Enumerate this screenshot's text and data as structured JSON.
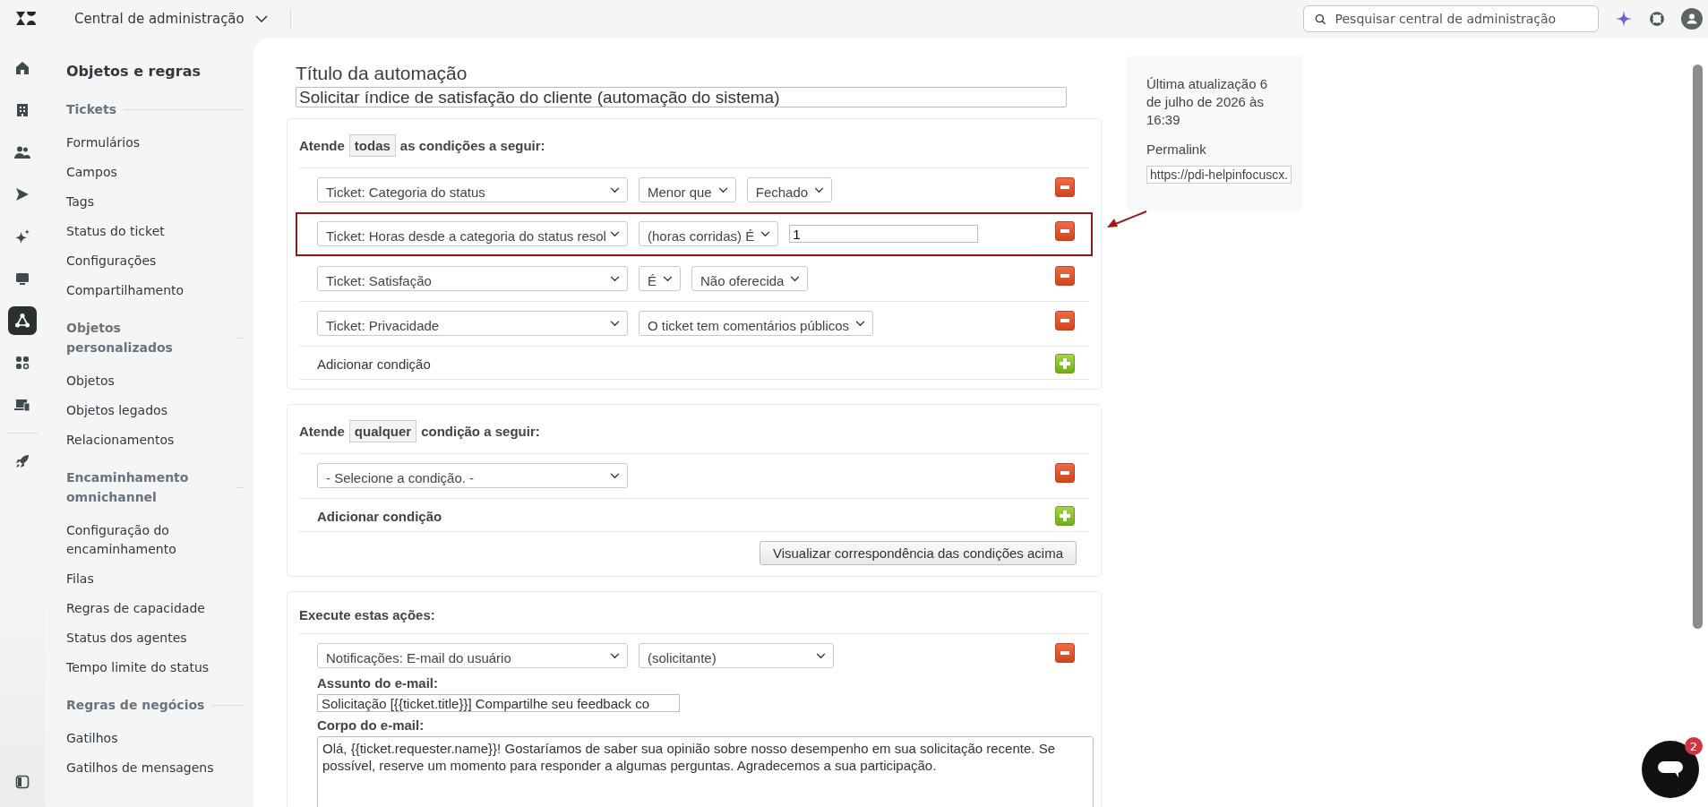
{
  "header": {
    "product": "Central de administração",
    "search_placeholder": "Pesquisar central de administração"
  },
  "rail": [
    {
      "kind": "home",
      "selected": false
    },
    {
      "kind": "building",
      "selected": false
    },
    {
      "kind": "people",
      "selected": false
    },
    {
      "kind": "send",
      "selected": false
    },
    {
      "kind": "sparkle",
      "selected": false
    },
    {
      "kind": "monitor",
      "selected": false
    },
    {
      "kind": "objects",
      "selected": true
    },
    {
      "kind": "apps",
      "selected": false
    },
    {
      "kind": "devices",
      "selected": false
    },
    {
      "kind": "rocket",
      "selected": false
    }
  ],
  "sidebar": {
    "title": "Objetos e regras",
    "sections": [
      {
        "heading": "Tickets",
        "items": [
          "Formulários",
          "Campos",
          "Tags",
          "Status do ticket",
          "Configurações",
          "Compartilhamento"
        ]
      },
      {
        "heading": "Objetos personalizados",
        "items": [
          "Objetos",
          "Objetos legados",
          "Relacionamentos"
        ]
      },
      {
        "heading": "Encaminhamento omnichannel",
        "items": [
          "Configuração do encaminhamento",
          "Filas",
          "Regras de capacidade",
          "Status dos agentes",
          "Tempo limite do status"
        ]
      },
      {
        "heading": "Regras de negócios",
        "items": [
          "Gatilhos",
          "Gatilhos de mensagens"
        ]
      }
    ]
  },
  "automation": {
    "title_label": "Título da automação",
    "title_value": "Solicitar índice de satisfação do cliente (automação do sistema)",
    "all_conditions": {
      "prefix": "Atende",
      "quantifier": "todas",
      "suffix": "as condições a seguir:",
      "add_label": "Adicionar condição",
      "rows": [
        {
          "highlighted": false,
          "controls": [
            {
              "kind": "select",
              "value": "Ticket: Categoria do status"
            },
            {
              "kind": "select",
              "value": "Menor que"
            },
            {
              "kind": "select",
              "value": "Fechado"
            }
          ]
        },
        {
          "highlighted": true,
          "controls": [
            {
              "kind": "select",
              "value": "Ticket: Horas desde a categoria do status resol"
            },
            {
              "kind": "select",
              "value": "(horas corridas) É"
            },
            {
              "kind": "input",
              "value": "1"
            }
          ]
        },
        {
          "highlighted": false,
          "controls": [
            {
              "kind": "select",
              "value": "Ticket: Satisfação"
            },
            {
              "kind": "select",
              "value": "É"
            },
            {
              "kind": "select",
              "value": "Não oferecida"
            }
          ]
        },
        {
          "highlighted": false,
          "controls": [
            {
              "kind": "select",
              "value": "Ticket: Privacidade"
            },
            {
              "kind": "select",
              "value": "O ticket tem comentários públicos"
            }
          ]
        }
      ]
    },
    "any_conditions": {
      "prefix": "Atende",
      "quantifier": "qualquer",
      "suffix": "condição a seguir:",
      "add_label": "Adicionar condição",
      "preview_button": "Visualizar correspondência das condições acima",
      "rows": [
        {
          "highlighted": false,
          "controls": [
            {
              "kind": "select",
              "value": "- Selecione a condição. -"
            }
          ]
        }
      ]
    },
    "actions": {
      "heading": "Execute estas ações:",
      "rows": [
        {
          "highlighted": false,
          "controls": [
            {
              "kind": "select",
              "value": "Notificações: E-mail do usuário"
            },
            {
              "kind": "select",
              "value": "(solicitante)"
            }
          ]
        }
      ],
      "subject_label": "Assunto do e-mail:",
      "subject_value": "Solicitação [{{ticket.title}}] Compartilhe seu feedback co",
      "body_label": "Corpo do e-mail:",
      "body_value": "Olá, {{ticket.requester.name}}! Gostaríamos de saber sua opinião sobre nosso desempenho em sua solicitação recente. Se possível, reserve um momento para responder a algumas perguntas. Agradecemos a sua participação."
    }
  },
  "info": {
    "updated": "Última atualização 6 de julho de 2026 às 16:39",
    "permalink_label": "Permalink",
    "permalink_value": "https://pdi-helpinfocuscx."
  },
  "chat": {
    "badge": "2"
  }
}
